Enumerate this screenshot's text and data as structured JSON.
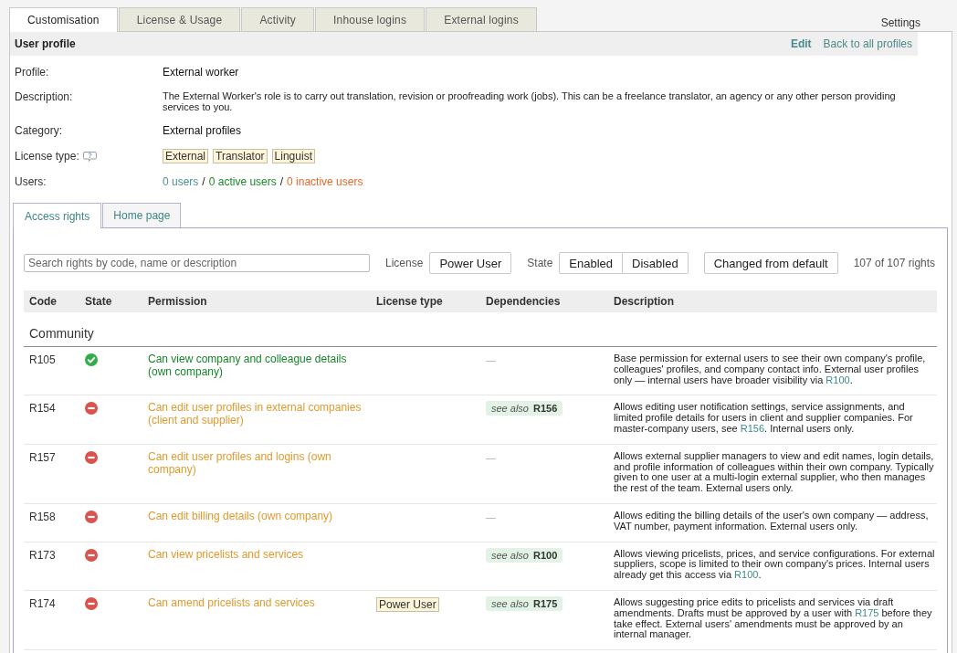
{
  "top_tabs": [
    {
      "label": "Customisation",
      "selected": true
    },
    {
      "label": "License & Usage",
      "selected": false
    },
    {
      "label": "Activity",
      "selected": false
    },
    {
      "label": "Inhouse logins",
      "selected": false
    },
    {
      "label": "External logins",
      "selected": false
    }
  ],
  "settings_link": "Settings",
  "profile": {
    "title": "User profile",
    "actions": [
      {
        "label": "Edit",
        "kind": "primary"
      },
      {
        "label": "Back to all profiles",
        "kind": "secondary"
      }
    ],
    "fields": [
      {
        "kind": "text",
        "label": "Profile:",
        "value": "External worker"
      },
      {
        "kind": "paragraph",
        "label": "Description:",
        "value": "The External Worker's role is to carry out translation, revision or proofreading work (jobs). This can be a freelance translator, an agency or any other person providing services to you."
      },
      {
        "kind": "text",
        "label": "Category:",
        "value": "External profiles"
      },
      {
        "kind": "tags",
        "label": "License type:",
        "help": true,
        "tags": [
          "External",
          "Translator",
          "Linguist"
        ]
      },
      {
        "kind": "counts",
        "label": "Users:",
        "separator": "/",
        "items": [
          {
            "label": "0 users",
            "color": "#4a9090"
          },
          {
            "label": "0 active users",
            "color": "#1a8a2a"
          },
          {
            "label": "0 inactive users",
            "color": "#e8682a"
          }
        ]
      }
    ]
  },
  "sub_tabs": [
    {
      "label": "Access rights",
      "selected": true
    },
    {
      "label": "Home page",
      "selected": false
    }
  ],
  "toolbar": {
    "search": {
      "placeholder": "Search rights by code, name or description"
    },
    "filters": [
      {
        "label": "License",
        "options": [
          {
            "label": "Power User",
            "selected": false
          }
        ]
      },
      {
        "label": "State",
        "options": [
          {
            "label": "Enabled",
            "selected": false
          },
          {
            "label": "Disabled",
            "selected": false
          }
        ]
      }
    ],
    "toggle": {
      "label": "Changed from default",
      "selected": false
    },
    "count": "107 of 107 rights"
  },
  "table": {
    "columns": [
      "Code",
      "State",
      "Permission",
      "License type",
      "Dependencies",
      "Description"
    ],
    "groups": [
      {
        "title": "Community",
        "rows": [
          {
            "code": "R105",
            "enabled": true,
            "permission": "Can view company and colleague details (own company)",
            "dependency": {
              "kind": "none",
              "text": "—"
            },
            "description": [
              {
                "kind": "text",
                "text": "Base permission for external users to see their own company's profile, colleagues' profiles, and company contact info. External user profiles only — internal users have broader visibility via "
              },
              {
                "kind": "link",
                "text": "R100"
              },
              {
                "kind": "text",
                "text": "."
              }
            ]
          },
          {
            "code": "R154",
            "enabled": false,
            "permission": "Can edit user profiles in external companies (client and supplier)",
            "dependency": {
              "kind": "see_also",
              "prefix": "see also",
              "code": "R156"
            },
            "description": [
              {
                "kind": "text",
                "text": "Allows editing user notification settings, service assignments, and limited profile details for users in client and supplier companies. For master-company users, see "
              },
              {
                "kind": "link",
                "text": "R156"
              },
              {
                "kind": "text",
                "text": ". Internal users only."
              }
            ]
          },
          {
            "code": "R157",
            "enabled": false,
            "permission": "Can edit user profiles and logins (own company)",
            "dependency": {
              "kind": "none",
              "text": "—"
            },
            "description": [
              {
                "kind": "text",
                "text": "Allows external supplier managers to view and edit names, login details, and profile information of colleagues within their own company. Typically given to one user at a multi-login external supplier, who then manages the rest of the team. External users only."
              }
            ]
          },
          {
            "code": "R158",
            "enabled": false,
            "permission": "Can edit billing details (own company)",
            "dependency": {
              "kind": "none",
              "text": "—"
            },
            "description": [
              {
                "kind": "text",
                "text": "Allows editing the billing details of the user's own company — address, VAT number, payment information. External users only."
              }
            ]
          },
          {
            "code": "R173",
            "enabled": false,
            "permission": "Can view pricelists and services",
            "dependency": {
              "kind": "see_also",
              "prefix": "see also",
              "code": "R100"
            },
            "description": [
              {
                "kind": "text",
                "text": "Allows viewing pricelists, prices, and service configurations. For external suppliers, scope is limited to their own company's prices. Internal users already get this access via "
              },
              {
                "kind": "link",
                "text": "R100"
              },
              {
                "kind": "text",
                "text": "."
              }
            ]
          },
          {
            "code": "R174",
            "enabled": false,
            "permission": "Can amend pricelists and services",
            "license_type": "Power User",
            "dependency": {
              "kind": "see_also",
              "prefix": "see also",
              "code": "R175"
            },
            "description": [
              {
                "kind": "text",
                "text": "Allows suggesting price edits to pricelists and services via draft amendments. Drafts must be approved by a user with "
              },
              {
                "kind": "link",
                "text": "R175"
              },
              {
                "kind": "text",
                "text": " before they take effect. External users' amendments must be approved by an internal manager."
              }
            ]
          }
        ]
      }
    ]
  }
}
